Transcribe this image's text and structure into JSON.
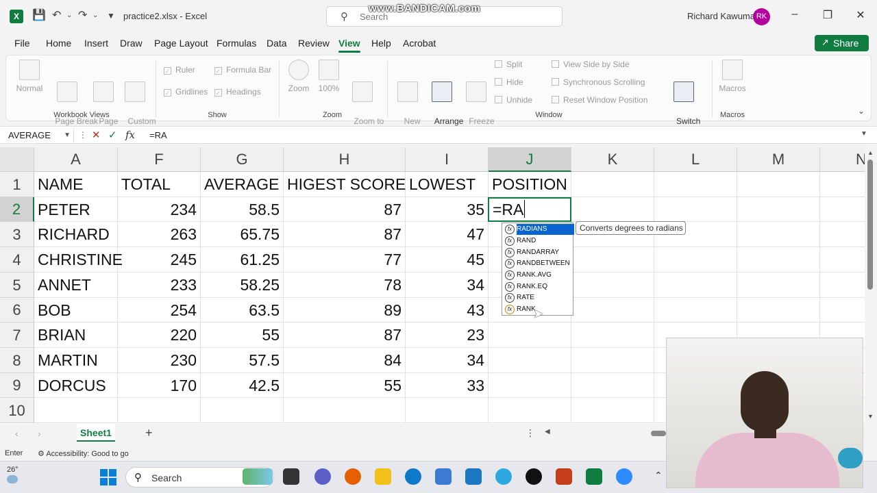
{
  "title_bar": {
    "logo": "X",
    "document_title": "practice2.xlsx  -  Excel",
    "search_placeholder": "Search",
    "watermark": "www.BANDICAM.com",
    "user_name": "Richard Kawuma",
    "user_initials": "RK"
  },
  "ribbon_tabs": [
    "File",
    "Home",
    "Insert",
    "Draw",
    "Page Layout",
    "Formulas",
    "Data",
    "Review",
    "View",
    "Help",
    "Acrobat"
  ],
  "active_tab": "View",
  "share_label": "Share",
  "ribbon": {
    "workbook_views": {
      "label": "Workbook Views",
      "normal": "Normal",
      "page_break": "Page Break\nPreview",
      "page_layout": "Page\nLayout",
      "custom_views": "Custom\nViews"
    },
    "show": {
      "label": "Show",
      "ruler": "Ruler",
      "formula_bar": "Formula Bar",
      "gridlines": "Gridlines",
      "headings": "Headings"
    },
    "zoom": {
      "label": "Zoom",
      "zoom": "Zoom",
      "hundred": "100%",
      "zoom_to_selection": "Zoom to\nSelection"
    },
    "window": {
      "label": "Window",
      "new_window": "New\nWindow",
      "arrange_all": "Arrange\nAll",
      "freeze_panes": "Freeze\nPanes",
      "split": "Split",
      "hide": "Hide",
      "unhide": "Unhide",
      "view_side_by_side": "View Side by Side",
      "sync_scrolling": "Synchronous Scrolling",
      "reset_position": "Reset Window Position",
      "switch_windows": "Switch\nWindows"
    },
    "macros": {
      "label": "Macros",
      "macros": "Macros"
    }
  },
  "formula_bar": {
    "name_box": "AVERAGE",
    "fx": "fx",
    "formula": "=RA"
  },
  "columns": [
    "A",
    "F",
    "G",
    "H",
    "I",
    "J",
    "K",
    "L",
    "M",
    "N"
  ],
  "selected_column": "J",
  "rows": [
    "1",
    "2",
    "3",
    "4",
    "5",
    "6",
    "7",
    "8",
    "9",
    "10"
  ],
  "selected_row": "2",
  "table": {
    "headers": [
      "NAME",
      "TOTAL",
      "AVERAGE",
      "HIGEST SCORE",
      "LOWEST",
      "POSITION"
    ],
    "data": [
      [
        "PETER",
        "234",
        "58.5",
        "87",
        "35"
      ],
      [
        "RICHARD",
        "263",
        "65.75",
        "87",
        "47"
      ],
      [
        "CHRISTINE",
        "245",
        "61.25",
        "77",
        "45"
      ],
      [
        "ANNET",
        "233",
        "58.25",
        "78",
        "34"
      ],
      [
        "BOB",
        "254",
        "63.5",
        "89",
        "43"
      ],
      [
        "BRIAN",
        "220",
        "55",
        "87",
        "23"
      ],
      [
        "MARTIN",
        "230",
        "57.5",
        "84",
        "34"
      ],
      [
        "DORCUS",
        "170",
        "42.5",
        "55",
        "33"
      ]
    ],
    "active_cell_text": "=RA"
  },
  "autocomplete": {
    "items": [
      "RADIANS",
      "RAND",
      "RANDARRAY",
      "RANDBETWEEN",
      "RANK.AVG",
      "RANK.EQ",
      "RATE",
      "RANK"
    ],
    "highlighted": "RADIANS",
    "tooltip": "Converts degrees to radians"
  },
  "sheet_tabs": [
    "Sheet1"
  ],
  "status_bar": {
    "mode": "Enter",
    "accessibility": "Accessibility: Good to go"
  },
  "taskbar": {
    "temperature": "26°",
    "search_label": "Search"
  }
}
